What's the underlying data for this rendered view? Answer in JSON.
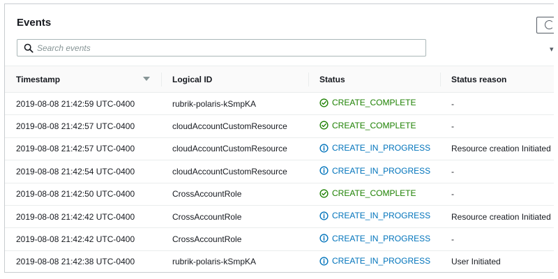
{
  "panel": {
    "title": "Events",
    "refresh_icon": "refresh-icon",
    "search_placeholder": "Search events"
  },
  "colors": {
    "complete": "#1d8102",
    "in_progress": "#0073bb",
    "border": "#eaeded"
  },
  "columns": [
    "Timestamp",
    "Logical ID",
    "Status",
    "Status reason"
  ],
  "rows": [
    {
      "timestamp": "2019-08-08 21:42:59 UTC-0400",
      "logical_id": "rubrik-polaris-kSmpKA",
      "status": "CREATE_COMPLETE",
      "status_icon": "check-circle-icon",
      "reason": "-"
    },
    {
      "timestamp": "2019-08-08 21:42:57 UTC-0400",
      "logical_id": "cloudAccountCustomResource",
      "status": "CREATE_COMPLETE",
      "status_icon": "check-circle-icon",
      "reason": "-"
    },
    {
      "timestamp": "2019-08-08 21:42:57 UTC-0400",
      "logical_id": "cloudAccountCustomResource",
      "status": "CREATE_IN_PROGRESS",
      "status_icon": "info-circle-icon",
      "reason": "Resource creation Initiated"
    },
    {
      "timestamp": "2019-08-08 21:42:54 UTC-0400",
      "logical_id": "cloudAccountCustomResource",
      "status": "CREATE_IN_PROGRESS",
      "status_icon": "info-circle-icon",
      "reason": "-"
    },
    {
      "timestamp": "2019-08-08 21:42:50 UTC-0400",
      "logical_id": "CrossAccountRole",
      "status": "CREATE_COMPLETE",
      "status_icon": "check-circle-icon",
      "reason": "-"
    },
    {
      "timestamp": "2019-08-08 21:42:42 UTC-0400",
      "logical_id": "CrossAccountRole",
      "status": "CREATE_IN_PROGRESS",
      "status_icon": "info-circle-icon",
      "reason": "Resource creation Initiated"
    },
    {
      "timestamp": "2019-08-08 21:42:42 UTC-0400",
      "logical_id": "CrossAccountRole",
      "status": "CREATE_IN_PROGRESS",
      "status_icon": "info-circle-icon",
      "reason": "-"
    },
    {
      "timestamp": "2019-08-08 21:42:38 UTC-0400",
      "logical_id": "rubrik-polaris-kSmpKA",
      "status": "CREATE_IN_PROGRESS",
      "status_icon": "info-circle-icon",
      "reason": "User Initiated"
    }
  ]
}
